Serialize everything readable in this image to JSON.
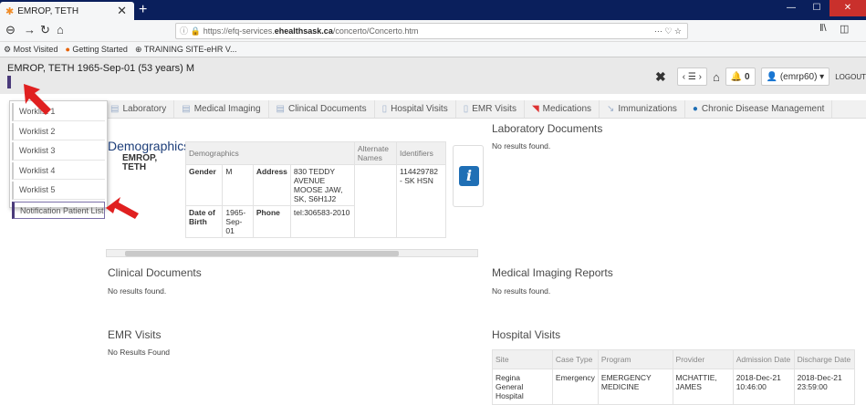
{
  "browser": {
    "tab_title": "EMROP, TETH",
    "new_tab": "+",
    "url_prefix": "https://efq-services.",
    "url_domain": "ehealthsask.ca",
    "url_suffix": "/concerto/Concerto.htm",
    "url_menu": "··· ♡ ☆",
    "bookmarks": [
      {
        "icon": "settings-icon",
        "label": "Most Visited"
      },
      {
        "icon": "firefox-icon",
        "label": "Getting Started"
      },
      {
        "icon": "globe-icon",
        "label": "TRAINING SITE-eHR V..."
      }
    ]
  },
  "header": {
    "patient_name": "EMROP, TETH 1965-Sep-01 (53 years) M",
    "notifications_count": "0",
    "user": "(emrp60)",
    "logout": "LOGOUT"
  },
  "tabs": [
    {
      "label": "Laboratory",
      "icon": "document-icon"
    },
    {
      "label": "Medical Imaging",
      "icon": "document-icon"
    },
    {
      "label": "Clinical Documents",
      "icon": "document-icon"
    },
    {
      "label": "Hospital Visits",
      "icon": "hospital-icon"
    },
    {
      "label": "EMR Visits",
      "icon": "emr-icon"
    },
    {
      "label": "Medications",
      "icon": "pill-icon"
    },
    {
      "label": "Immunizations",
      "icon": "syringe-icon"
    },
    {
      "label": "Chronic Disease Management",
      "icon": "circle-icon"
    }
  ],
  "worklist": [
    "Worklist 1",
    "Worklist 2",
    "Worklist 3",
    "Worklist 4",
    "Worklist 5",
    "Notification Patient List"
  ],
  "demographics": {
    "title": "Demographics",
    "name_line1": "EMROP,",
    "name_line2": "TETH",
    "headers": {
      "demographics": "Demographics",
      "alternate_names": "Alternate Names",
      "identifiers": "Identifiers"
    },
    "gender_label": "Gender",
    "gender": "M",
    "address_label": "Address",
    "address": "830 TEDDY AVENUE MOOSE JAW, SK, S6H1J2",
    "identifier": "114429782 - SK HSN",
    "dob_label": "Date of Birth",
    "dob": "1965-Sep-01",
    "phone_label": "Phone",
    "phone": "tel:306583-2010"
  },
  "sections": {
    "lab_docs": {
      "title": "Laboratory Documents",
      "msg": "No results found."
    },
    "clinical_docs": {
      "title": "Clinical Documents",
      "msg": "No results found."
    },
    "med_imaging": {
      "title": "Medical Imaging Reports",
      "msg": "No results found."
    },
    "emr_visits": {
      "title": "EMR Visits",
      "msg": "No Results Found"
    },
    "hospital_visits": {
      "title": "Hospital Visits",
      "columns": [
        "Site",
        "Case Type",
        "Program",
        "Provider",
        "Admission Date",
        "Discharge Date"
      ],
      "rows": [
        [
          "Regina General Hospital",
          "Emergency",
          "EMERGENCY MEDICINE",
          "MCHATTIE, JAMES",
          "2018-Dec-21 10:46:00",
          "2018-Dec-21 23:59:00"
        ]
      ]
    }
  },
  "colors": {
    "arrow": "#e02020",
    "accent": "#1d3e79"
  }
}
